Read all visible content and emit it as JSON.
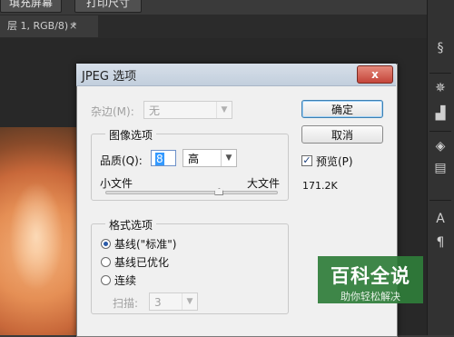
{
  "toolbar": {
    "fill_screen": "填充屏幕",
    "print_size": "打印尺寸"
  },
  "document_tab": {
    "title": "层 1, RGB/8) *",
    "close_symbol": "×"
  },
  "dialog": {
    "title": "JPEG 选项",
    "close_symbol": "x",
    "matte": {
      "label": "杂边(M):",
      "value": "无"
    },
    "image_options": {
      "legend": "图像选项",
      "quality_label": "品质(Q):",
      "quality_value": "8",
      "quality_preset": "高",
      "small_file": "小文件",
      "large_file": "大文件",
      "slider_fraction": 0.66
    },
    "format_options": {
      "legend": "格式选项",
      "options": [
        "基线(\"标准\")",
        "基线已优化",
        "连续"
      ],
      "selected_index": 0,
      "scans_label": "扫描:",
      "scans_value": "3"
    },
    "buttons": {
      "ok": "确定",
      "cancel": "取消"
    },
    "preview": {
      "label": "预览(P)",
      "checked": true,
      "file_size": "171.2K"
    }
  },
  "watermark": {
    "title": "百科全说",
    "subtitle": "助你轻松解决"
  }
}
